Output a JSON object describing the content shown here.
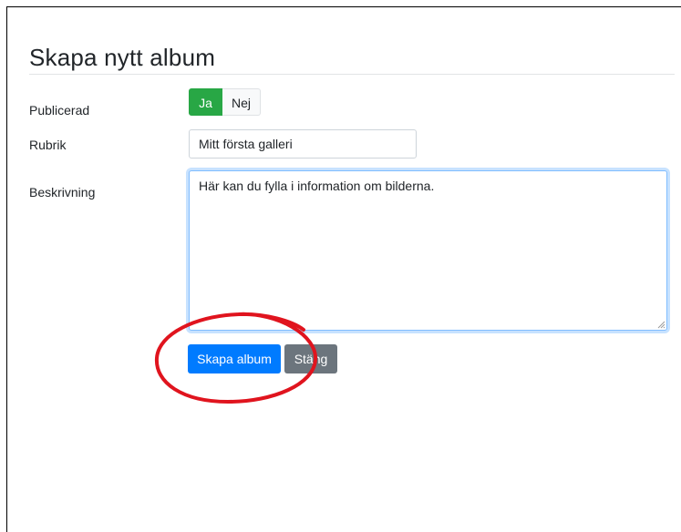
{
  "page": {
    "title": "Skapa nytt album"
  },
  "form": {
    "published": {
      "label": "Publicerad",
      "options": [
        "Ja",
        "Nej"
      ],
      "selected": "Ja"
    },
    "heading": {
      "label": "Rubrik",
      "value": "Mitt första galleri"
    },
    "description": {
      "label": "Beskrivning",
      "value": "Här kan du fylla i information om bilderna."
    }
  },
  "actions": {
    "create_label": "Skapa album",
    "close_label": "Stäng"
  },
  "colors": {
    "success": "#28a745",
    "primary": "#007bff",
    "secondary": "#6c757d",
    "annotation": "#e0141e"
  }
}
